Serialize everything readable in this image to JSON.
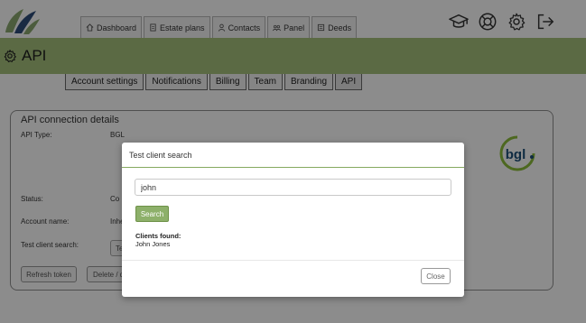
{
  "nav": {
    "tabs": [
      {
        "label": "Dashboard",
        "icon": "home-icon"
      },
      {
        "label": "Estate plans",
        "icon": "document-icon"
      },
      {
        "label": "Contacts",
        "icon": "person-icon"
      },
      {
        "label": "Panel",
        "icon": "group-icon"
      },
      {
        "label": "Deeds",
        "icon": "list-icon"
      }
    ],
    "right_icons": [
      "graduation-cap-icon",
      "lifebuoy-icon",
      "gear-icon",
      "logout-icon"
    ]
  },
  "header": {
    "title": "API",
    "accent": "#a6c27c"
  },
  "subtabs": [
    {
      "label": "Account settings"
    },
    {
      "label": "Notifications"
    },
    {
      "label": "Billing"
    },
    {
      "label": "Team"
    },
    {
      "label": "Branding"
    },
    {
      "label": "API",
      "active": true
    }
  ],
  "panel": {
    "title": "API connection details",
    "api_type_label": "API Type:",
    "api_type_value": "BGL",
    "status_label": "Status:",
    "status_value": "Co",
    "account_name_label": "Account name:",
    "account_name_value": "Inhe",
    "test_search_label": "Test client search:",
    "test_button": "Te",
    "refresh_token": "Refresh token",
    "delete_button": "Delete / d",
    "logo_text": "bgl"
  },
  "modal": {
    "title": "Test client search",
    "input_value": "john",
    "search_button": "Search",
    "clients_found_label": "Clients found:",
    "clients": [
      "John Jones"
    ],
    "close_button": "Close",
    "accent": "#8db06a"
  }
}
